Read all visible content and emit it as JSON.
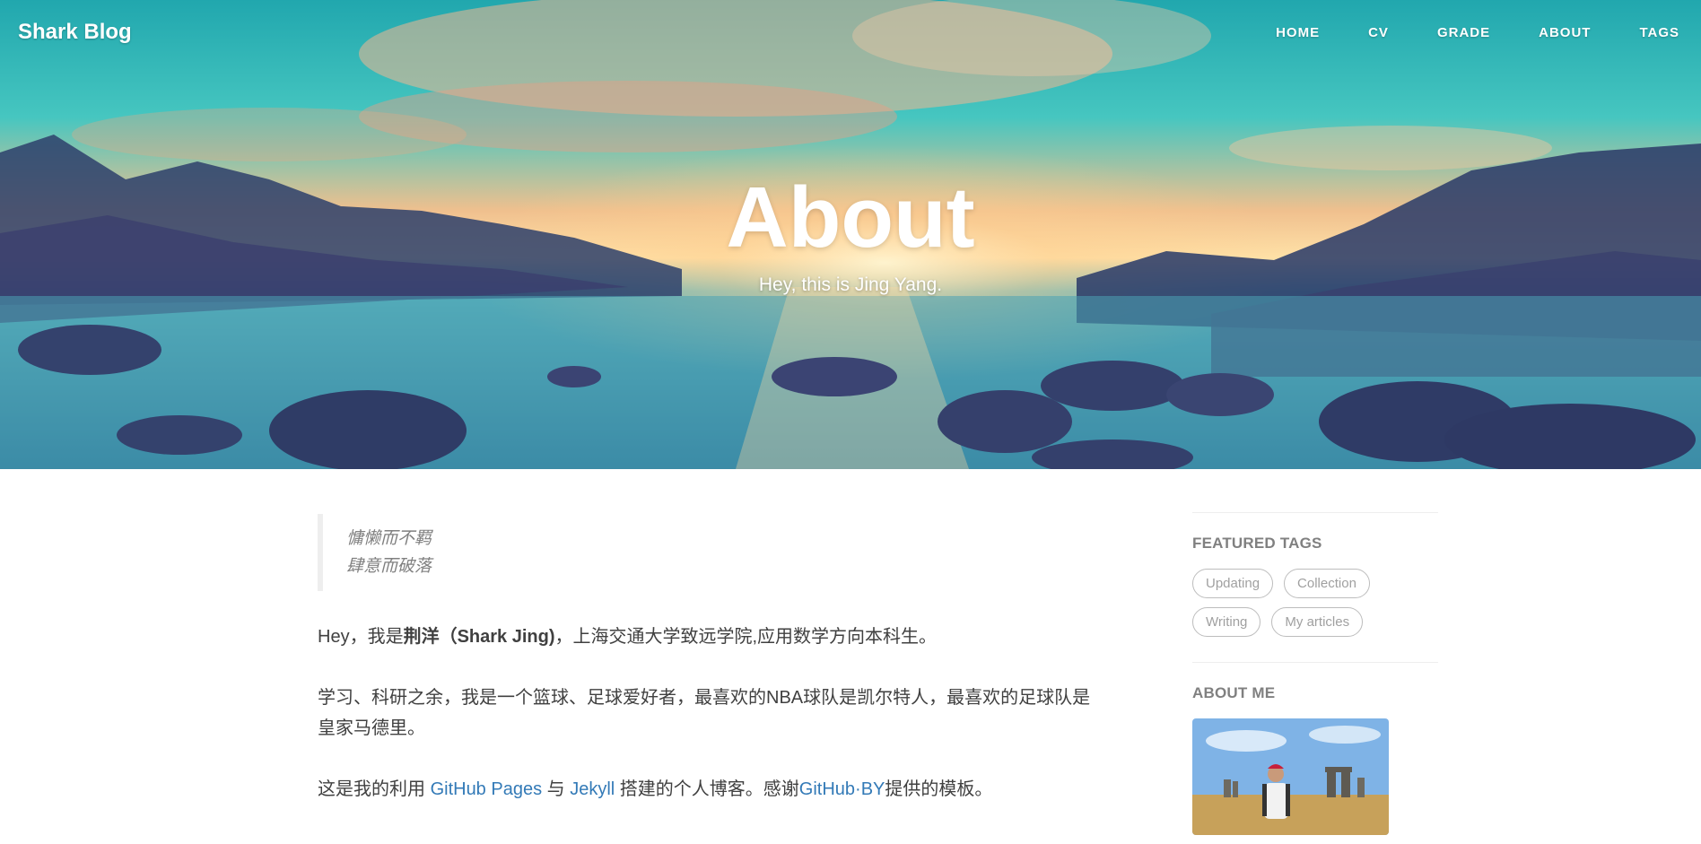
{
  "nav": {
    "brand": "Shark Blog",
    "items": [
      "HOME",
      "CV",
      "GRADE",
      "ABOUT",
      "TAGS"
    ]
  },
  "hero": {
    "title": "About",
    "subtitle": "Hey, this is Jing Yang."
  },
  "content": {
    "quote_lines": [
      "慵懒而不羁",
      "肆意而破落"
    ],
    "para1": {
      "prefix": "Hey，我是",
      "bold": "荆洋（Shark Jing)",
      "suffix": "，上海交通大学致远学院,应用数学方向本科生。"
    },
    "para2": "学习、科研之余，我是一个篮球、足球爱好者，最喜欢的NBA球队是凯尔特人，最喜欢的足球队是皇家马德里。",
    "para3": {
      "prefix": "这是我的利用 ",
      "link1": "GitHub Pages",
      "mid1": " 与 ",
      "link2": "Jekyll",
      "mid2": " 搭建的个人博客。感谢",
      "link3": "GitHub·BY",
      "suffix": "提供的模板。"
    }
  },
  "sidebar": {
    "featured_tags_title": "FEATURED TAGS",
    "tags": [
      "Updating",
      "Collection",
      "Writing",
      "My articles"
    ],
    "about_me_title": "ABOUT ME"
  },
  "colors": {
    "link": "#337ab7",
    "text": "#404040",
    "muted": "#808080"
  }
}
